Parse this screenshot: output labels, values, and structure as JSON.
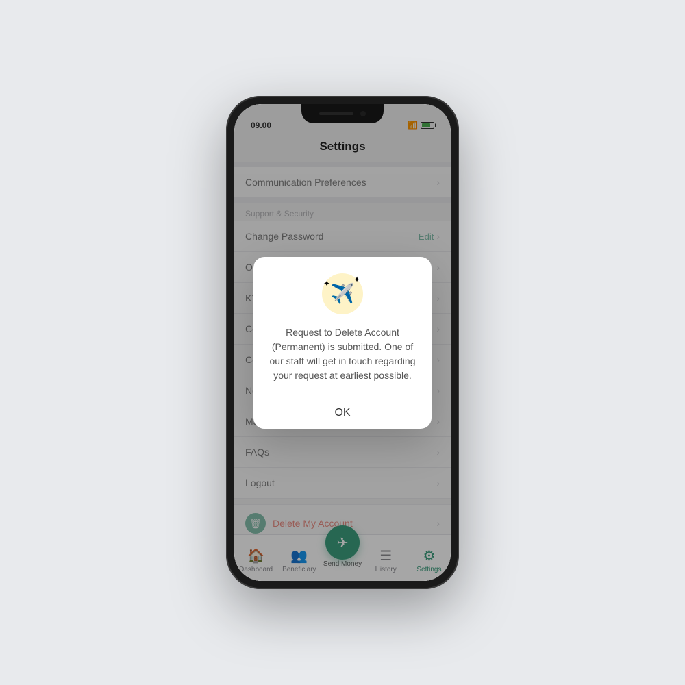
{
  "status_bar": {
    "time": "09.00",
    "wifi": "wifi",
    "battery": "battery"
  },
  "page": {
    "title": "Settings"
  },
  "settings": {
    "items_top": [
      {
        "label": "Communication Preferences"
      }
    ],
    "section_support": "Support & Security",
    "items_support": [
      {
        "label": "Change Password",
        "edit": "Edit",
        "has_chevron": true
      },
      {
        "label": "Our",
        "has_chevron": true
      },
      {
        "label": "KYC",
        "has_chevron": true
      },
      {
        "label": "Cor",
        "has_chevron": true
      },
      {
        "label": "Cor",
        "has_chevron": true
      },
      {
        "label": "Not",
        "has_chevron": true
      },
      {
        "label": "Mar",
        "has_chevron": true
      },
      {
        "label": "FAQs",
        "has_chevron": true
      },
      {
        "label": "Logout",
        "has_chevron": true
      }
    ],
    "delete_account": "Delete My Account"
  },
  "modal": {
    "message": "Request to Delete Account (Permanent) is submitted. One of our staff will get in touch regarding your request at earliest possible.",
    "ok_label": "OK"
  },
  "bottom_nav": {
    "items": [
      {
        "label": "Dashboard",
        "icon": "🏠",
        "active": false
      },
      {
        "label": "Beneficiary",
        "icon": "👥",
        "active": false
      },
      {
        "label": "Send Money",
        "icon": "✈",
        "active": false,
        "center": true
      },
      {
        "label": "History",
        "icon": "☰",
        "active": false
      },
      {
        "label": "Settings",
        "icon": "⚙",
        "active": true
      }
    ]
  }
}
